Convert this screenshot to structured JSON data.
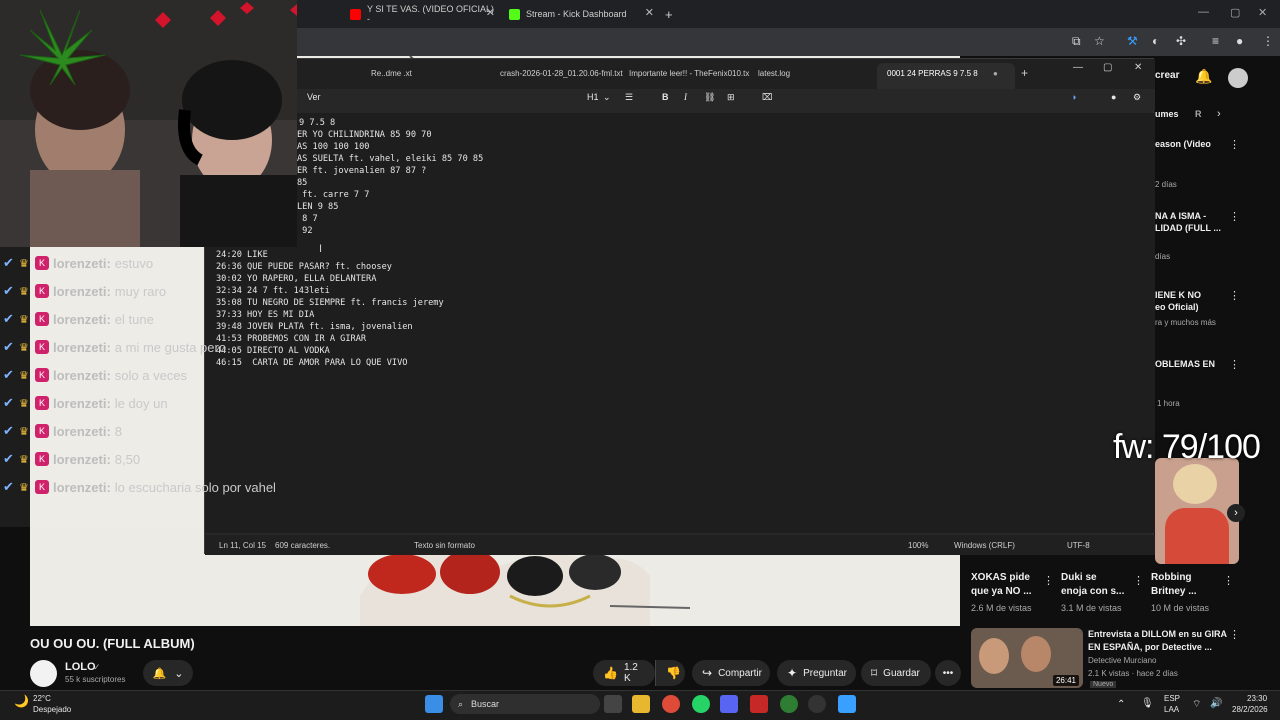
{
  "browser": {
    "tabs": [
      {
        "label": "Y SI TE VAS. (VIDEO OFICIAL) -",
        "icon": "youtube-icon"
      },
      {
        "label": "Stream - Kick Dashboard",
        "icon": "kick-icon"
      }
    ],
    "new_tab": "+"
  },
  "notepad": {
    "tabs": [
      "Re..dme .xt",
      "crash-2026-01-28_01.20.06-fml.txt",
      "Importante leer!! - TheFenix010.tx",
      "latest.log",
      "0001 24 PERRAS 9 7.5 8"
    ],
    "add_tab": "+",
    "menu_view": "Ver",
    "heading_menu": "H1",
    "bold": "B",
    "italic": "I",
    "lines": [
      "9 7.5 8",
      "ER YO CHILINDRINA 85 90 70",
      "AS 100 100 100",
      "AS SUELTA ft. vahel, eleiki 85 70 85",
      "ER ft. jovenalien 87 87 ?",
      "85",
      " ft. carre 7 7",
      "LEN 9 85",
      " 8 7",
      " 92",
      "",
      "24:20 LIKE",
      "26:36 QUE PUEDE PASAR? ft. choosey",
      "30:02 YO RAPERO, ELLA DELANTERA",
      "32:34 24 7 ft. 143leti",
      "35:08 TU NEGRO DE SIEMPRE ft. francis jeremy",
      "37:33 HOY ES MI DIA",
      "39:48 JOVEN PLATA ft. isma, jovenalien",
      "41:53 PROBEMOS CON IR A GIRAR",
      "44:05 DIRECTO AL VODKA",
      "46:15  CARTA DE AMOR PARA LO QUE VIVO"
    ],
    "status": {
      "position": "Ln 11, Col 15",
      "chars": "609 caracteres.",
      "format": "Texto sin formato",
      "zoom": "100%",
      "line_ending": "Windows (CRLF)",
      "encoding": "UTF-8"
    }
  },
  "chat": {
    "messages": [
      {
        "user": "lorenzeti:",
        "text": "estuvo"
      },
      {
        "user": "lorenzeti:",
        "text": "muy raro"
      },
      {
        "user": "lorenzeti:",
        "text": "el tune"
      },
      {
        "user": "lorenzeti:",
        "text": "a mi me gusta pero"
      },
      {
        "user": "lorenzeti:",
        "text": "solo a veces"
      },
      {
        "user": "lorenzeti:",
        "text": "le doy un"
      },
      {
        "user": "lorenzeti:",
        "text": "8"
      },
      {
        "user": "lorenzeti:",
        "text": "8,50"
      },
      {
        "user": "lorenzeti:",
        "text": "lo escucharia solo por vahel"
      }
    ]
  },
  "overlay": {
    "score": "fw: 79/100"
  },
  "youtube": {
    "video_title": "OU OU OU. (FULL ALBUM)",
    "channel": "LOLO",
    "subscribers": "55 k suscriptores",
    "like_count": "1.2 K",
    "share": "Compartir",
    "ask": "Preguntar",
    "save": "Guardar",
    "more": "•••",
    "rail_header": "crear",
    "rail_chip": "umes",
    "rail_chip2": "R",
    "rail_items": [
      {
        "title": "eason (Video",
        "meta": "2 días"
      },
      {
        "title": "NA A ISMA -\nLIDAD (FULL ...",
        "meta": "días"
      },
      {
        "title": "IENE K NO\neo Oficial)",
        "meta": "ra y muchos más"
      },
      {
        "title": "OBLEMAS EN",
        "meta": "1 hora"
      }
    ],
    "shorts": [
      {
        "title": "XOKAS pide\nque ya NO ...",
        "views": "2.6 M de vistas"
      },
      {
        "title": "Duki se\nenoja con s...",
        "views": "3.1 M de vistas"
      },
      {
        "title": "Robbing\nBritney ...",
        "views": "10 M de vistas"
      }
    ],
    "rec_video": {
      "title": "Entrevista a DILLOM en su GIRA\nEN ESPAÑA, por Detective ...",
      "channel": "Detective Murciano",
      "meta": "2.1 K vistas · hace 2 días",
      "duration": "26:41",
      "badge": "Nuevo"
    }
  },
  "taskbar": {
    "weather_temp": "22°C",
    "weather_desc": "Despejado",
    "search": "Buscar",
    "lang": "ESP",
    "lang2": "LAA",
    "time": "23:30",
    "date": "28/2/2026"
  }
}
